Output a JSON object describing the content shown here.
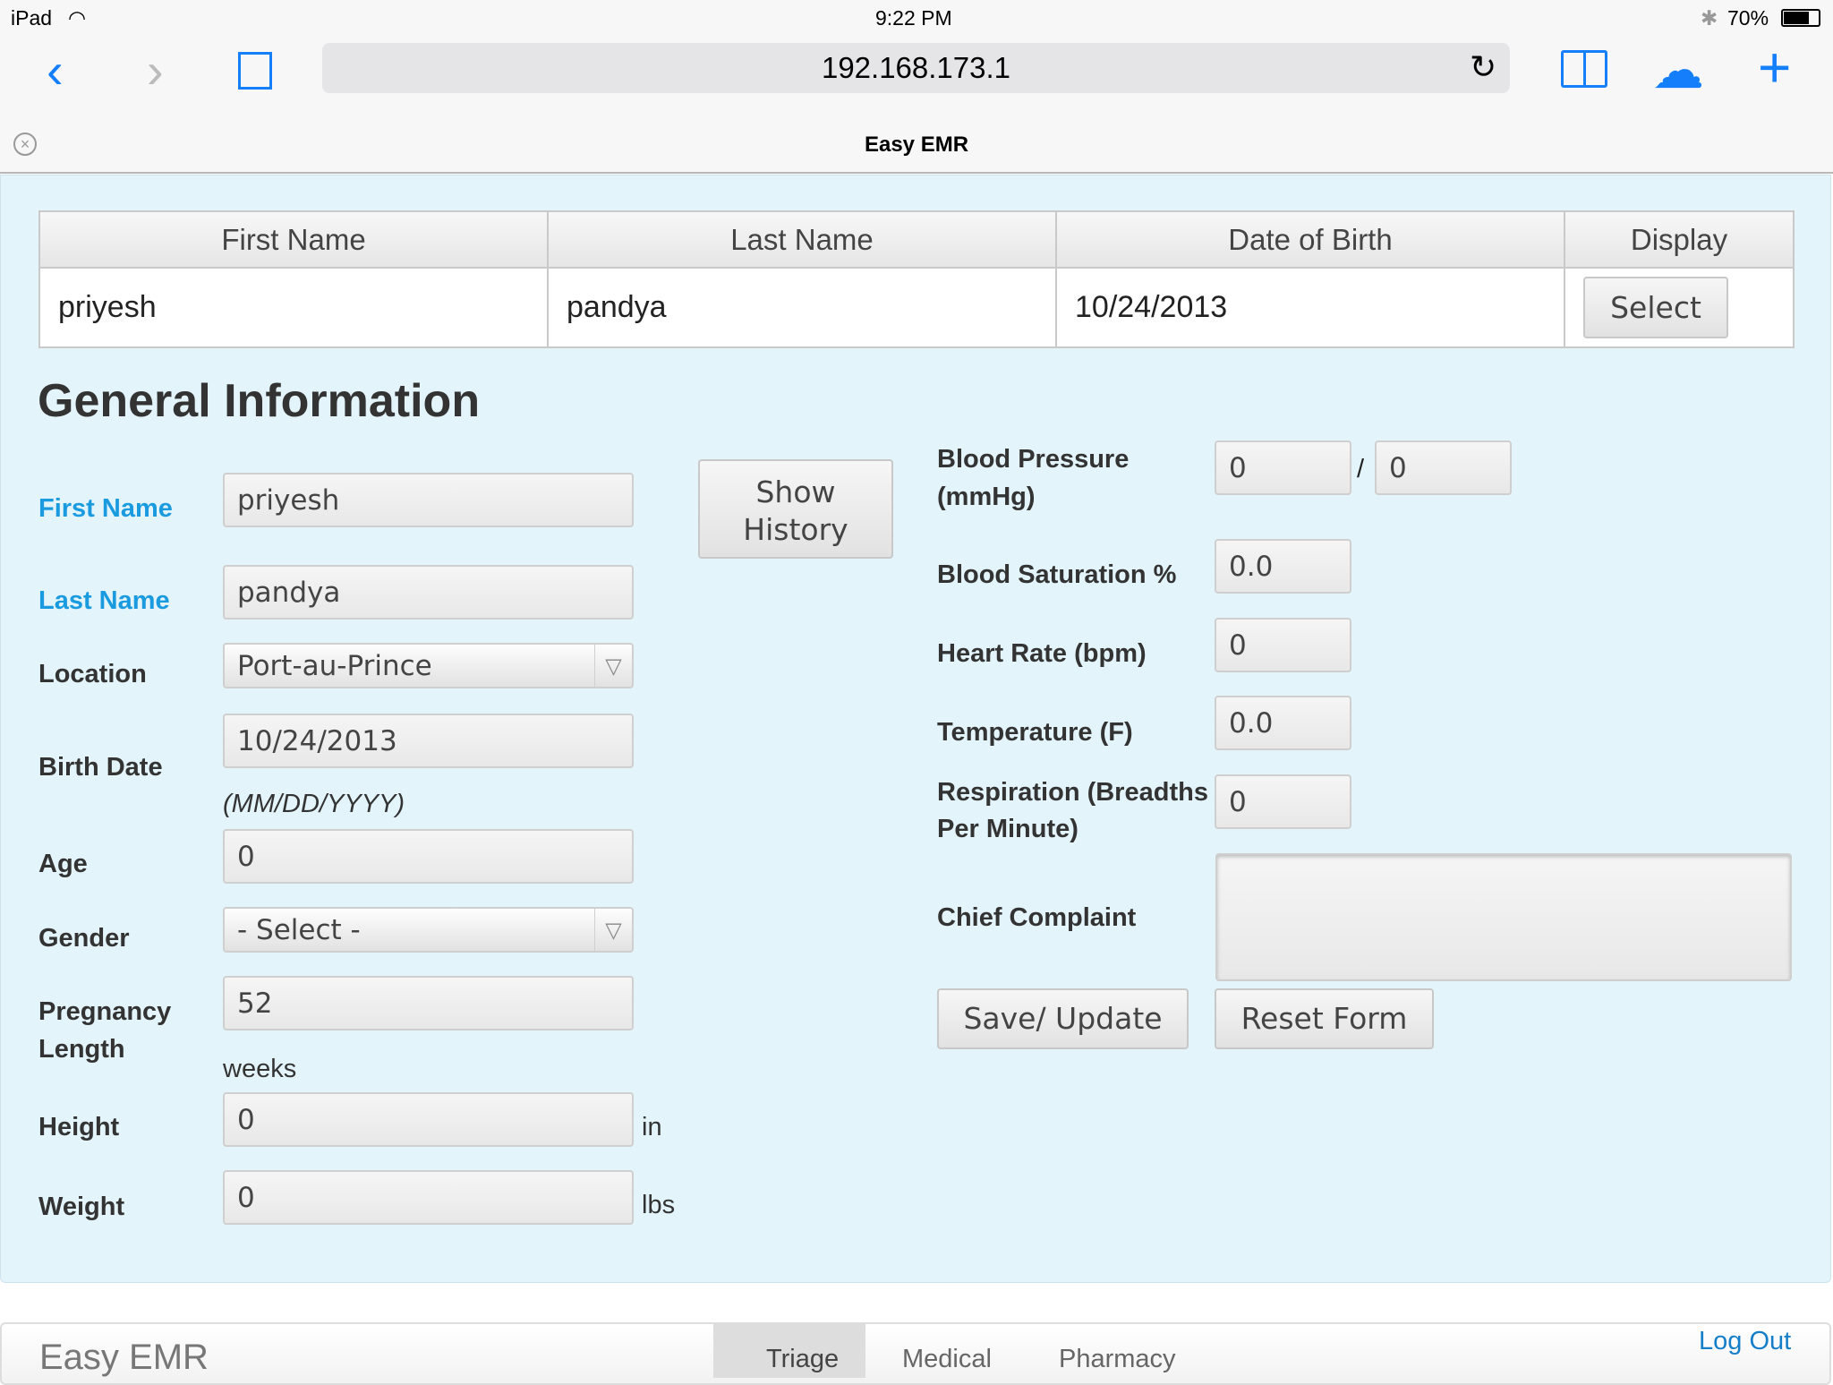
{
  "status_bar": {
    "device": "iPad",
    "time": "9:22 PM",
    "battery": "70%"
  },
  "browser": {
    "url": "192.168.173.1",
    "tab_title": "Easy EMR"
  },
  "patient_table": {
    "headers": [
      "First Name",
      "Last Name",
      "Date of Birth",
      "Display"
    ],
    "row": {
      "first_name": "priyesh",
      "last_name": "pandya",
      "dob": "10/24/2013",
      "select_label": "Select"
    }
  },
  "form": {
    "title": "General Information",
    "show_history_line1": "Show",
    "show_history_line2": "History",
    "first_name": {
      "label": "First Name",
      "value": "priyesh"
    },
    "last_name": {
      "label": "Last Name",
      "value": "pandya"
    },
    "location": {
      "label": "Location",
      "value": "Port-au-Prince"
    },
    "birth_date": {
      "label": "Birth Date",
      "value": "10/24/2013",
      "hint": "(MM/DD/YYYY)"
    },
    "age": {
      "label": "Age",
      "value": "0"
    },
    "gender": {
      "label": "Gender",
      "value": "- Select -"
    },
    "pregnancy": {
      "label1": "Pregnancy",
      "label2": "Length",
      "value": "52",
      "unit": "weeks"
    },
    "height": {
      "label": "Height",
      "value": "0",
      "unit": "in"
    },
    "weight": {
      "label": "Weight",
      "value": "0",
      "unit": "lbs"
    },
    "bp": {
      "label1": "Blood Pressure",
      "label2": "(mmHg)",
      "systolic": "0",
      "separator": "/",
      "diastolic": "0"
    },
    "saturation": {
      "label": "Blood Saturation %",
      "value": "0.0"
    },
    "heart_rate": {
      "label": "Heart Rate (bpm)",
      "value": "0"
    },
    "temperature": {
      "label": "Temperature (F)",
      "value": "0.0"
    },
    "respiration": {
      "label1": "Respiration (Breadths",
      "label2": "Per Minute)",
      "value": "0"
    },
    "chief_complaint": {
      "label": "Chief Complaint",
      "value": ""
    },
    "save_label": "Save/ Update",
    "reset_label": "Reset Form"
  },
  "footer": {
    "brand": "Easy EMR",
    "tabs": [
      "Triage",
      "Medical",
      "Pharmacy"
    ],
    "logout": "Log Out"
  }
}
